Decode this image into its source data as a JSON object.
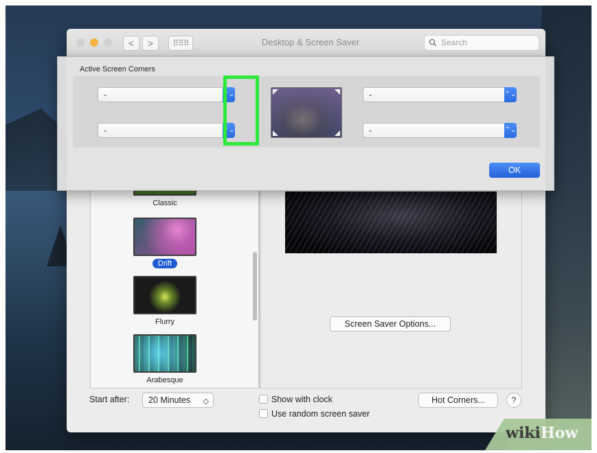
{
  "window": {
    "title": "Desktop & Screen Saver",
    "nav_back": "<",
    "nav_forward": ">",
    "grid": "⠿⠿⠿",
    "search_placeholder": "Search"
  },
  "savers": [
    {
      "label": "Classic",
      "selected": false
    },
    {
      "label": "Drift",
      "selected": true
    },
    {
      "label": "Flurry",
      "selected": false
    },
    {
      "label": "Arabesque",
      "selected": false
    }
  ],
  "preview": {
    "options_button": "Screen Saver Options..."
  },
  "bottom": {
    "start_after_label": "Start after:",
    "start_after_value": "20 Minutes",
    "show_clock": "Show with clock",
    "random_saver": "Use random screen saver",
    "hot_corners": "Hot Corners...",
    "help": "?"
  },
  "corners_sheet": {
    "title": "Active Screen Corners",
    "top_left": "-",
    "bottom_left": "-",
    "top_right": "-",
    "bottom_right": "-",
    "ok": "OK"
  },
  "watermark": {
    "part_a": "wiki",
    "part_b": "How"
  },
  "colors": {
    "accent": "#2a6be0",
    "highlight": "#2ee83a",
    "selected_label": "#1f5bd0"
  },
  "icons": {
    "chevron": "⌃⌄",
    "select_chevron": "◇"
  }
}
